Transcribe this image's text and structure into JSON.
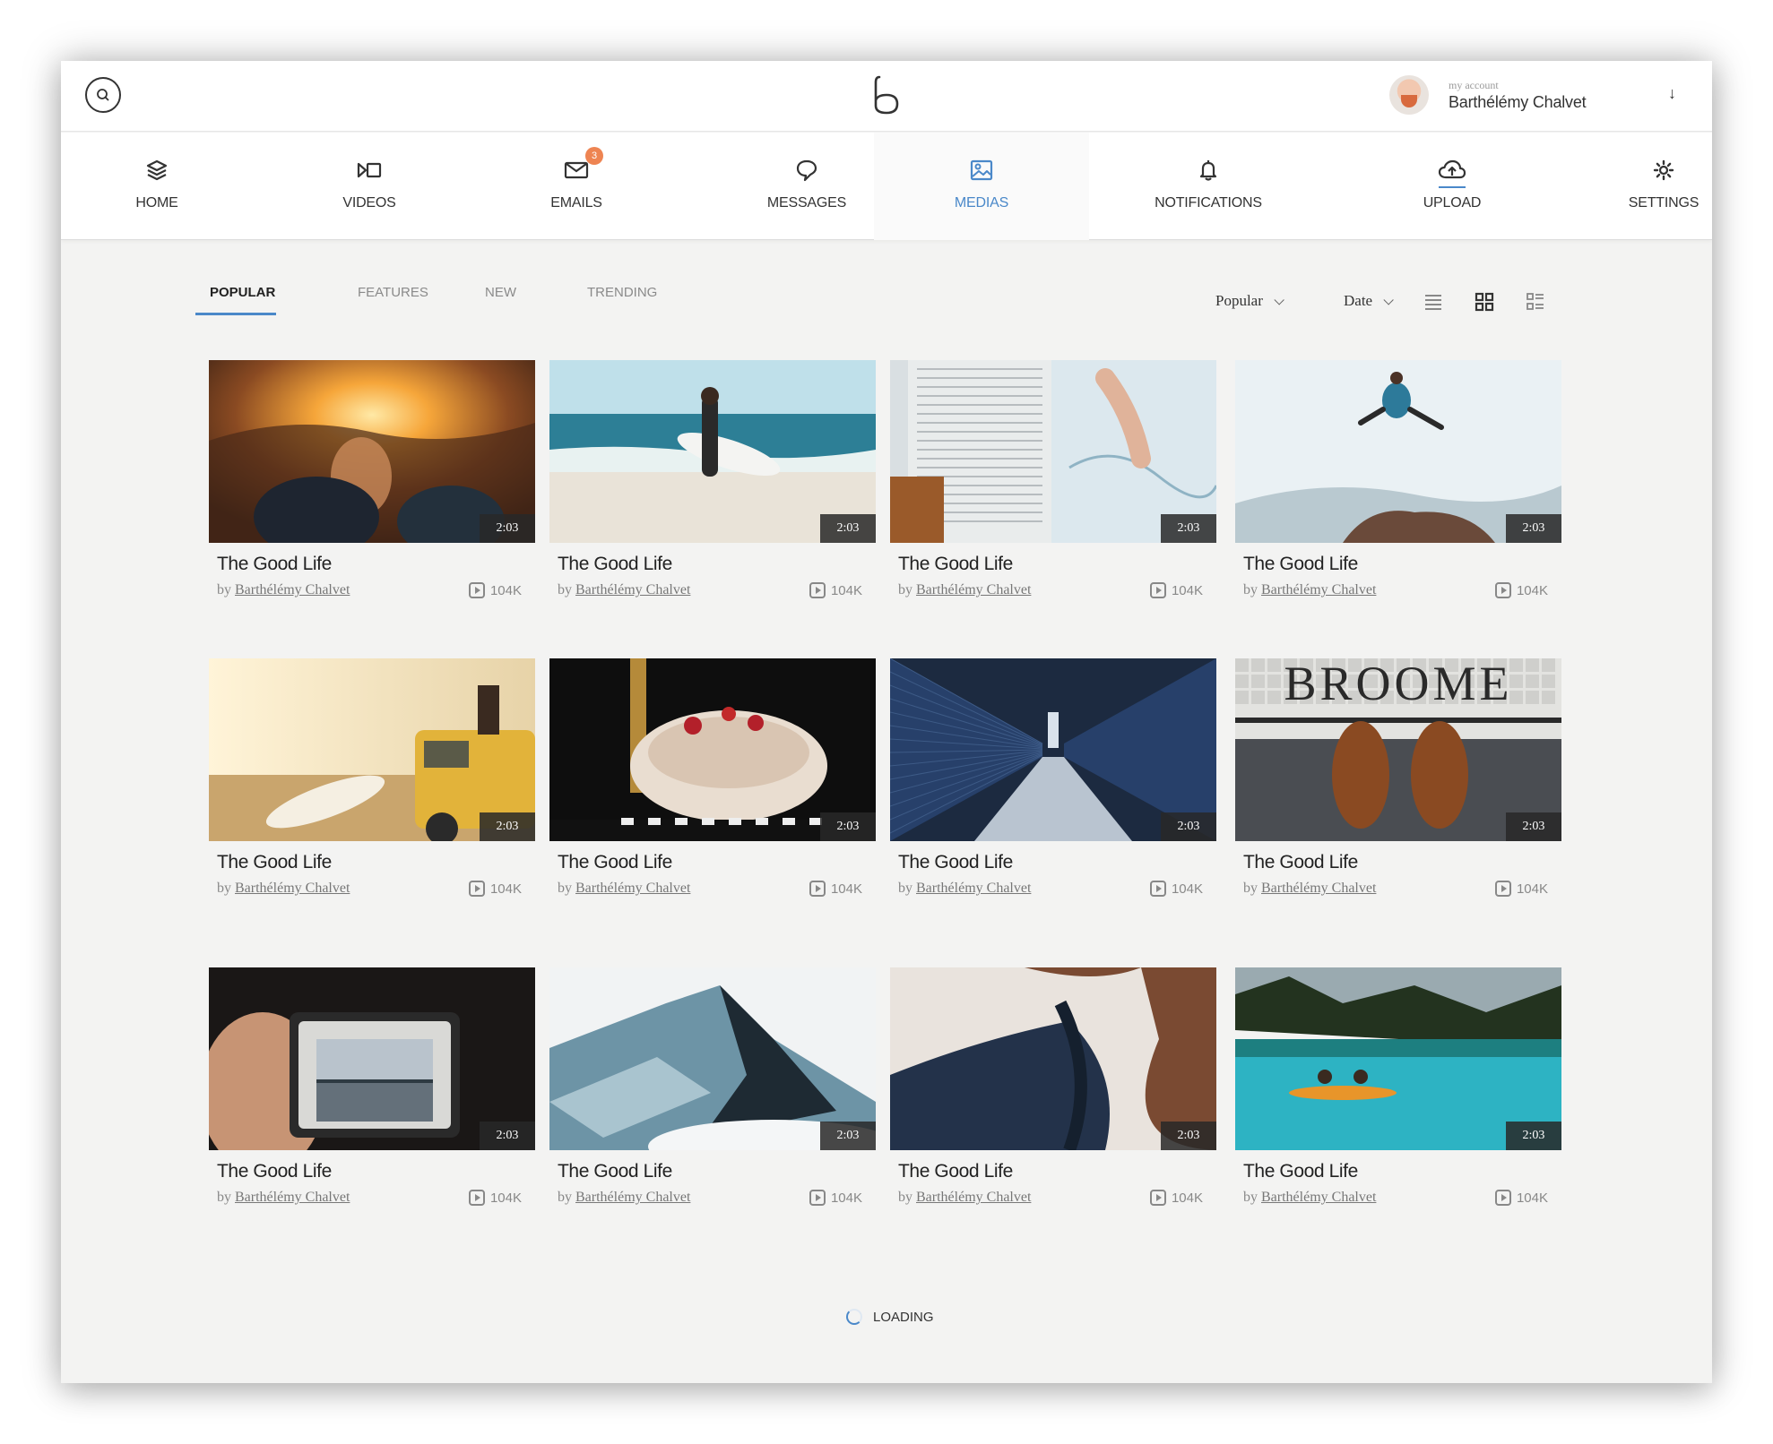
{
  "account": {
    "label": "my account",
    "name": "Barthélémy Chalvet"
  },
  "nav": {
    "items": [
      {
        "label": "HOME",
        "icon": "layers-icon"
      },
      {
        "label": "VIDEOS",
        "icon": "video-icon"
      },
      {
        "label": "EMAILS",
        "icon": "mail-icon",
        "badge": "3"
      },
      {
        "label": "MESSAGES",
        "icon": "chat-bubble-icon"
      },
      {
        "label": "MEDIAS",
        "icon": "image-icon",
        "active": true
      },
      {
        "label": "NOTIFICATIONS",
        "icon": "bell-icon"
      },
      {
        "label": "UPLOAD",
        "icon": "cloud-upload-icon"
      },
      {
        "label": "SETTINGS",
        "icon": "gear-icon"
      }
    ]
  },
  "tabs": [
    {
      "label": "POPULAR",
      "active": true
    },
    {
      "label": "FEATURES"
    },
    {
      "label": "NEW"
    },
    {
      "label": "TRENDING"
    }
  ],
  "sort": {
    "popular": "Popular",
    "date": "Date"
  },
  "colors": {
    "accent": "#4a88c9",
    "badge": "#ee8452"
  },
  "cards": [
    {
      "title": "The Good Life",
      "by": "by",
      "author": "Barthélémy Chalvet",
      "views": "104K",
      "duration": "2:03",
      "scene": "sunset-mountain"
    },
    {
      "title": "The Good Life",
      "by": "by",
      "author": "Barthélémy Chalvet",
      "views": "104K",
      "duration": "2:03",
      "scene": "surfer-beach"
    },
    {
      "title": "The Good Life",
      "by": "by",
      "author": "Barthélémy Chalvet",
      "views": "104K",
      "duration": "2:03",
      "scene": "map-newspaper"
    },
    {
      "title": "The Good Life",
      "by": "by",
      "author": "Barthélémy Chalvet",
      "views": "104K",
      "duration": "2:03",
      "scene": "jumping-man"
    },
    {
      "title": "The Good Life",
      "by": "by",
      "author": "Barthélémy Chalvet",
      "views": "104K",
      "duration": "2:03",
      "scene": "van-sunset"
    },
    {
      "title": "The Good Life",
      "by": "by",
      "author": "Barthélémy Chalvet",
      "views": "104K",
      "duration": "2:03",
      "scene": "dessert"
    },
    {
      "title": "The Good Life",
      "by": "by",
      "author": "Barthélémy Chalvet",
      "views": "104K",
      "duration": "2:03",
      "scene": "bridge"
    },
    {
      "title": "The Good Life",
      "by": "by",
      "author": "Barthélémy Chalvet",
      "views": "104K",
      "duration": "2:03",
      "scene": "broome-shoes",
      "sign": "BROOME"
    },
    {
      "title": "The Good Life",
      "by": "by",
      "author": "Barthélémy Chalvet",
      "views": "104K",
      "duration": "2:03",
      "scene": "camera"
    },
    {
      "title": "The Good Life",
      "by": "by",
      "author": "Barthélémy Chalvet",
      "views": "104K",
      "duration": "2:03",
      "scene": "snow-mountain"
    },
    {
      "title": "The Good Life",
      "by": "by",
      "author": "Barthélémy Chalvet",
      "views": "104K",
      "duration": "2:03",
      "scene": "collar"
    },
    {
      "title": "The Good Life",
      "by": "by",
      "author": "Barthélémy Chalvet",
      "views": "104K",
      "duration": "2:03",
      "scene": "canoe-lake"
    }
  ],
  "loading": "LOADING"
}
